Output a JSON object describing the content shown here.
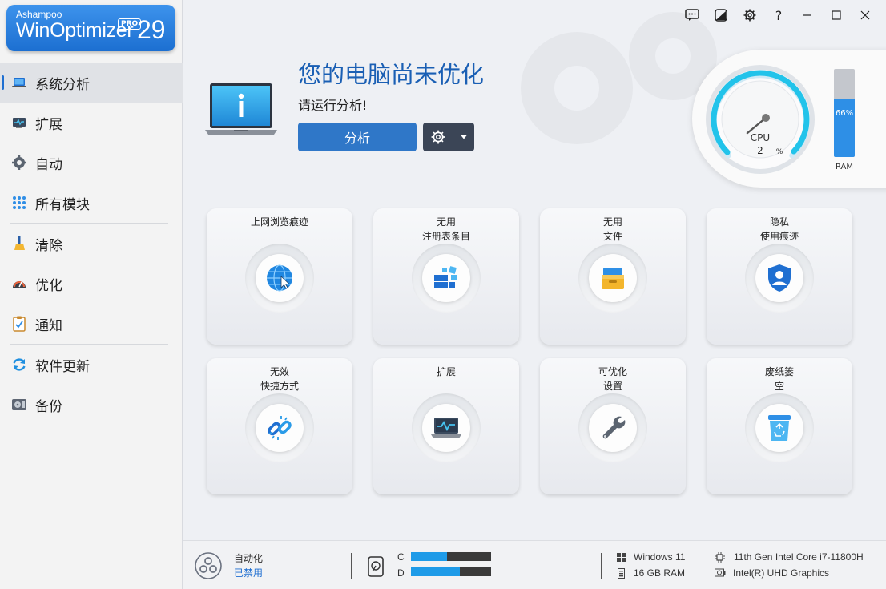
{
  "app": {
    "brand": "Ashampoo",
    "product": "WinOptimizer",
    "edition": "PRO",
    "version": "29"
  },
  "titlebar": {
    "feedback_icon": "feedback-icon",
    "skin_icon": "theme-icon",
    "settings_icon": "gear-icon",
    "help_label": "?",
    "minimize_label": "—",
    "maximize_label": "☐",
    "close_label": "✕"
  },
  "sidebar": {
    "items": [
      {
        "label": "系统分析",
        "icon": "laptop-icon"
      },
      {
        "label": "扩展",
        "icon": "monitor-pulse-icon"
      },
      {
        "label": "自动",
        "icon": "auto-gear-icon"
      },
      {
        "label": "所有模块",
        "icon": "grid-icon"
      },
      {
        "label": "清除",
        "icon": "broom-icon"
      },
      {
        "label": "优化",
        "icon": "speedometer-icon"
      },
      {
        "label": "通知",
        "icon": "clipboard-icon"
      },
      {
        "label": "软件更新",
        "icon": "refresh-icon"
      },
      {
        "label": "备份",
        "icon": "backup-drive-icon"
      }
    ]
  },
  "hero": {
    "title": "您的电脑尚未优化",
    "subtitle": "请运行分析!",
    "analyze_label": "分析"
  },
  "gauges": {
    "cpu_label": "CPU",
    "cpu_value": "2",
    "cpu_unit": "%",
    "ram_label": "RAM",
    "ram_percent_text": "66%",
    "ram_percent": 66,
    "cpu_percent": 2
  },
  "tiles": [
    {
      "label": "上网浏览痕迹",
      "icon": "globe-cursor-icon"
    },
    {
      "label": "无用\n注册表条目",
      "icon": "registry-blocks-icon"
    },
    {
      "label": "无用\n文件",
      "icon": "file-drawer-icon"
    },
    {
      "label": "隐私\n使用痕迹",
      "icon": "privacy-shield-icon"
    },
    {
      "label": "无效\n快捷方式",
      "icon": "broken-link-icon"
    },
    {
      "label": "扩展",
      "icon": "laptop-pulse-icon"
    },
    {
      "label": "可优化\n设置",
      "icon": "wrench-icon"
    },
    {
      "label": "废纸篓\n空",
      "icon": "recycle-bin-icon"
    }
  ],
  "footer": {
    "automation_label": "自动化",
    "automation_status": "已禁用",
    "drives": [
      {
        "letter": "C",
        "fill": 0.45
      },
      {
        "letter": "D",
        "fill": 0.61
      }
    ],
    "os": "Windows 11",
    "ram": "16 GB RAM",
    "cpu": "11th Gen Intel Core i7-11800H",
    "gpu": "Intel(R) UHD Graphics"
  },
  "colors": {
    "accent": "#1f6fd1",
    "title_blue": "#1a5fb4",
    "button_blue": "#2f77c8",
    "drive_fill": "#1e9be8",
    "ram_fill": "#2e8fe6",
    "gauge_cyan": "#22c3ea"
  }
}
